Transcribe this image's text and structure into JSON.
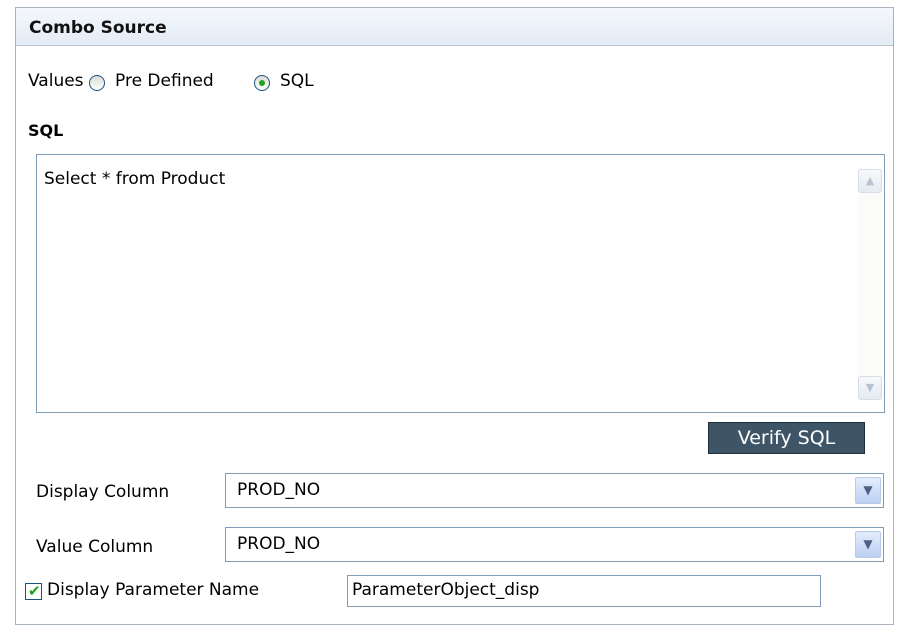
{
  "panel": {
    "title": "Combo Source"
  },
  "values": {
    "label": "Values",
    "options": [
      {
        "label": "Pre Defined",
        "selected": false
      },
      {
        "label": "SQL",
        "selected": true
      }
    ]
  },
  "sql": {
    "heading": "SQL",
    "query": "Select * from Product",
    "verify_label": "Verify SQL"
  },
  "display_column": {
    "label": "Display Column",
    "value": "PROD_NO"
  },
  "value_column": {
    "label": "Value Column",
    "value": "PROD_NO"
  },
  "display_parameter": {
    "label": "Display Parameter Name",
    "checked": true,
    "value": "ParameterObject_disp"
  },
  "colors": {
    "header_gradient_top": "#f4f8fc",
    "header_gradient_bottom": "#e3ebf4",
    "button_bg": "#3e5568",
    "check_green": "#21a121",
    "field_border": "#7f9db9"
  },
  "icons": {
    "scroll_up": "scroll-up-icon",
    "scroll_down": "scroll-down-icon",
    "dropdown": "chevron-down-icon",
    "radio_dot": "radio-dot-icon",
    "check": "checkmark-icon"
  }
}
